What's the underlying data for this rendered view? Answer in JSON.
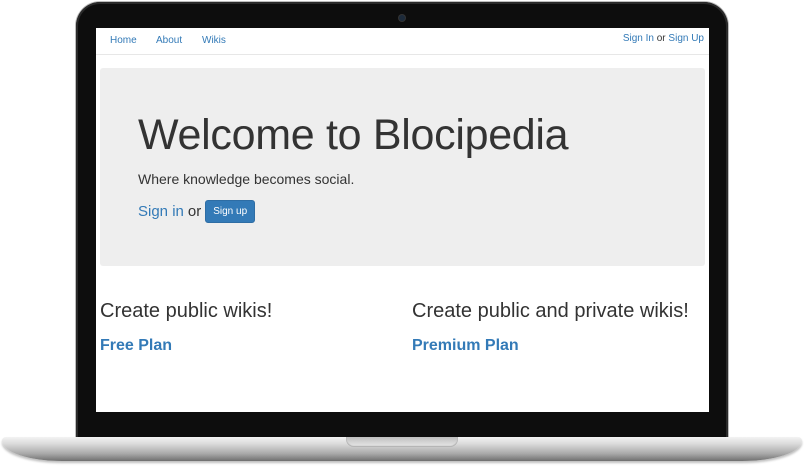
{
  "nav": {
    "links": [
      "Home",
      "About",
      "Wikis"
    ],
    "sign_in": "Sign In",
    "or": "or",
    "sign_up": "Sign Up"
  },
  "jumbotron": {
    "title": "Welcome to Blocipedia",
    "lead": "Where knowledge becomes social.",
    "sign_in": "Sign in",
    "or": "or",
    "sign_up_button": "Sign up"
  },
  "plans": [
    {
      "heading": "Create public wikis!",
      "link": "Free Plan"
    },
    {
      "heading": "Create public and private wikis!",
      "link": "Premium Plan"
    }
  ],
  "colors": {
    "link": "#337ab7",
    "jumbotron_bg": "#eeeeee",
    "text": "#333333",
    "bezel": "#0d0d0d"
  }
}
